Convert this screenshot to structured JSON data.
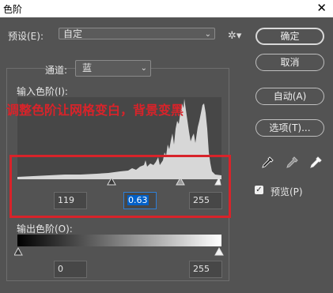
{
  "window": {
    "title": "色阶",
    "close_glyph": "✕"
  },
  "preset": {
    "label": "预设(E):",
    "value": "自定"
  },
  "channel": {
    "label": "通道:",
    "value": "蓝"
  },
  "input_levels": {
    "label": "输入色阶(I):",
    "black": "119",
    "gamma": "0.63",
    "white": "255"
  },
  "output_levels": {
    "label": "输出色阶(O):",
    "black": "0",
    "white": "255"
  },
  "annotation": {
    "text": "调整色阶让网格变白，背景变黑",
    "color": "#d8232a"
  },
  "buttons": {
    "ok": "确定",
    "cancel": "取消",
    "auto": "自动(A)",
    "options": "选项(T)..."
  },
  "preview": {
    "label": "预览(P)",
    "checked": true,
    "check_glyph": "✓"
  },
  "icons": {
    "settings": "gear-icon",
    "dropdown": "chevron-down-icon"
  },
  "colors": {
    "background": "#535353",
    "annotation_red": "#d8232a",
    "focus_blue": "#0060c8"
  }
}
